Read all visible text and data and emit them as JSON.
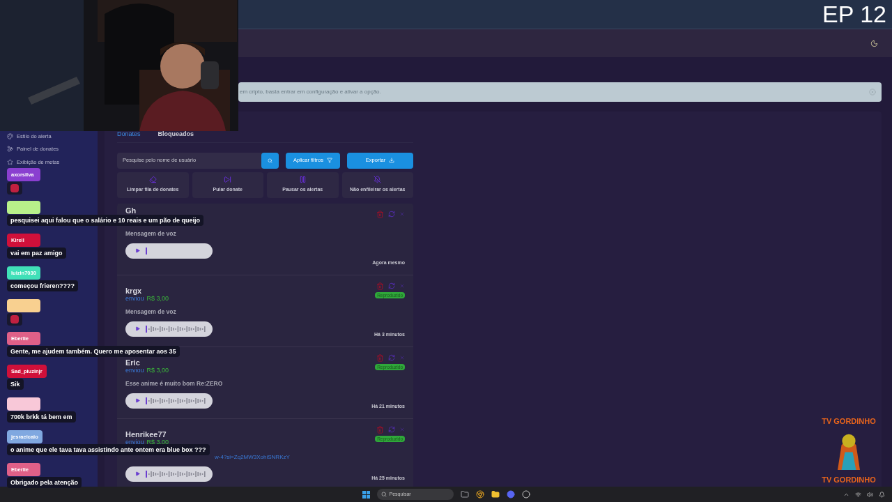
{
  "overlay": {
    "episode": "EP 12",
    "logo_top": "TV GORDINHO",
    "logo_bottom": "TV GORDINHO"
  },
  "banner": {
    "text": "em cripto, basta entrar em configuração e ativar a opção."
  },
  "sidebar": {
    "items": [
      {
        "label": "Estilo do alerta"
      },
      {
        "label": "Painel de donates"
      },
      {
        "label": "Exibição de metas"
      }
    ]
  },
  "tabs": [
    {
      "label": "Donates",
      "selected": true
    },
    {
      "label": "Bloqueados",
      "selected": false
    }
  ],
  "search": {
    "placeholder": "Pesquise pelo nome de usuário"
  },
  "buttons": [
    {
      "label": "Aplicar filtros",
      "kind": "filter"
    },
    {
      "label": "Exportar",
      "kind": "export"
    }
  ],
  "actions": [
    {
      "label": "Limpar fila de donates",
      "kind": "clear"
    },
    {
      "label": "Pular donate",
      "kind": "skip"
    },
    {
      "label": "Pausar os alertas",
      "kind": "pause"
    },
    {
      "label": "Não enfileirar os alertas",
      "kind": "mute"
    }
  ],
  "donations": [
    {
      "name": "Gh",
      "message": "Mensagem de voz",
      "kind": "text",
      "waveform": false,
      "time": "Agora mesmo"
    },
    {
      "name": "krgx",
      "sent": "enviou",
      "amount": "R$ 3,00",
      "status": "Reproduzido",
      "message": "Mensagem de voz",
      "kind": "text",
      "waveform": true,
      "time": "Há 3 minutos"
    },
    {
      "name": "Eric",
      "sent": "enviou",
      "amount": "R$ 3,00",
      "status": "Reproduzido",
      "message": "Esse anime é muito bom Re:ZERO",
      "kind": "text",
      "waveform": true,
      "time": "Há 21 minutos"
    },
    {
      "name": "Henrikee77",
      "sent": "enviou",
      "amount": "R$ 3,00",
      "status": "Reproduzido",
      "message": "w-4?si=Zq2MW3XohiSNRKzY",
      "kind": "link",
      "waveform": true,
      "time": "Há 25 minutos"
    }
  ],
  "chat": [
    {
      "user": "axorsilva",
      "color": "#8a3fd0",
      "kind": "emote"
    },
    {
      "color": "#b8f08a",
      "kind": "text",
      "text": "pesquisei aqui falou que o salário e 10 reais e um pão de queijo"
    },
    {
      "user": "Kirell",
      "color": "#d0103a",
      "kind": "text",
      "text": "vai em paz amigo"
    },
    {
      "user": "luizin7030",
      "color": "#40e0b8",
      "kind": "text",
      "text": "começou frieren????"
    },
    {
      "color": "#f8d090",
      "kind": "emote"
    },
    {
      "user": "Eberlie",
      "color": "#e06088",
      "kind": "text",
      "text": "Gente, me ajudem também. Quero me aposentar aos 35"
    },
    {
      "user": "Sad_piuzinjr",
      "color": "#d0103a",
      "kind": "text",
      "text": "Sik"
    },
    {
      "color": "#f8c8d8",
      "kind": "text",
      "text": "700k brkk tá bem em"
    },
    {
      "user": "jesraeicaio",
      "color": "#80a8e0",
      "kind": "text",
      "text": "o anime que ele tava tava assistindo ante ontem era blue box ???"
    },
    {
      "user": "Eberlie",
      "color": "#e06088",
      "kind": "text",
      "text": "Obrigado pela atenção"
    }
  ],
  "taskbar": {
    "search_placeholder": "Pesquisar"
  }
}
